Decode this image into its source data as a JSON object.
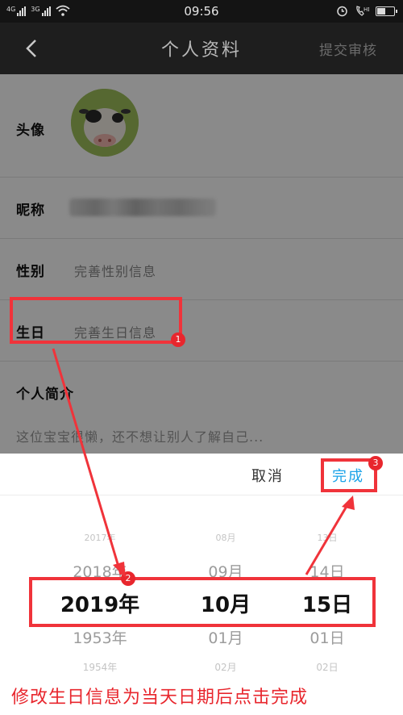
{
  "status_bar": {
    "time": "09:56",
    "net_tags": [
      "4G",
      "3G"
    ],
    "icons": [
      "signal-icon",
      "signal-icon",
      "wifi-icon",
      "alarm-icon",
      "call-icon",
      "battery-icon"
    ],
    "battery_level": 0.55
  },
  "nav": {
    "back_icon": "chevron-left-icon",
    "title": "个人资料",
    "submit_label": "提交审核"
  },
  "form": {
    "avatar_label": "头像",
    "nickname_label": "昵称",
    "gender_label": "性别",
    "gender_placeholder": "完善性别信息",
    "birthday_label": "生日",
    "birthday_placeholder": "完善生日信息",
    "bio_label": "个人简介",
    "bio_placeholder": "这位宝宝很懒，还不想让别人了解自己..."
  },
  "picker": {
    "cancel_label": "取消",
    "done_label": "完成",
    "years": [
      "2017年",
      "2018年",
      "2019年",
      "1953年",
      "1954年"
    ],
    "months": [
      "08月",
      "09月",
      "10月",
      "01月",
      "02月"
    ],
    "days": [
      "13日",
      "14日",
      "15日",
      "01日",
      "02日"
    ],
    "selected": {
      "year": "2019年",
      "month": "10月",
      "day": "15日"
    }
  },
  "annotations": {
    "badges": [
      "1",
      "2",
      "3"
    ],
    "caption": "修改生日信息为当天日期后点击完成",
    "color": "#e8262d"
  }
}
